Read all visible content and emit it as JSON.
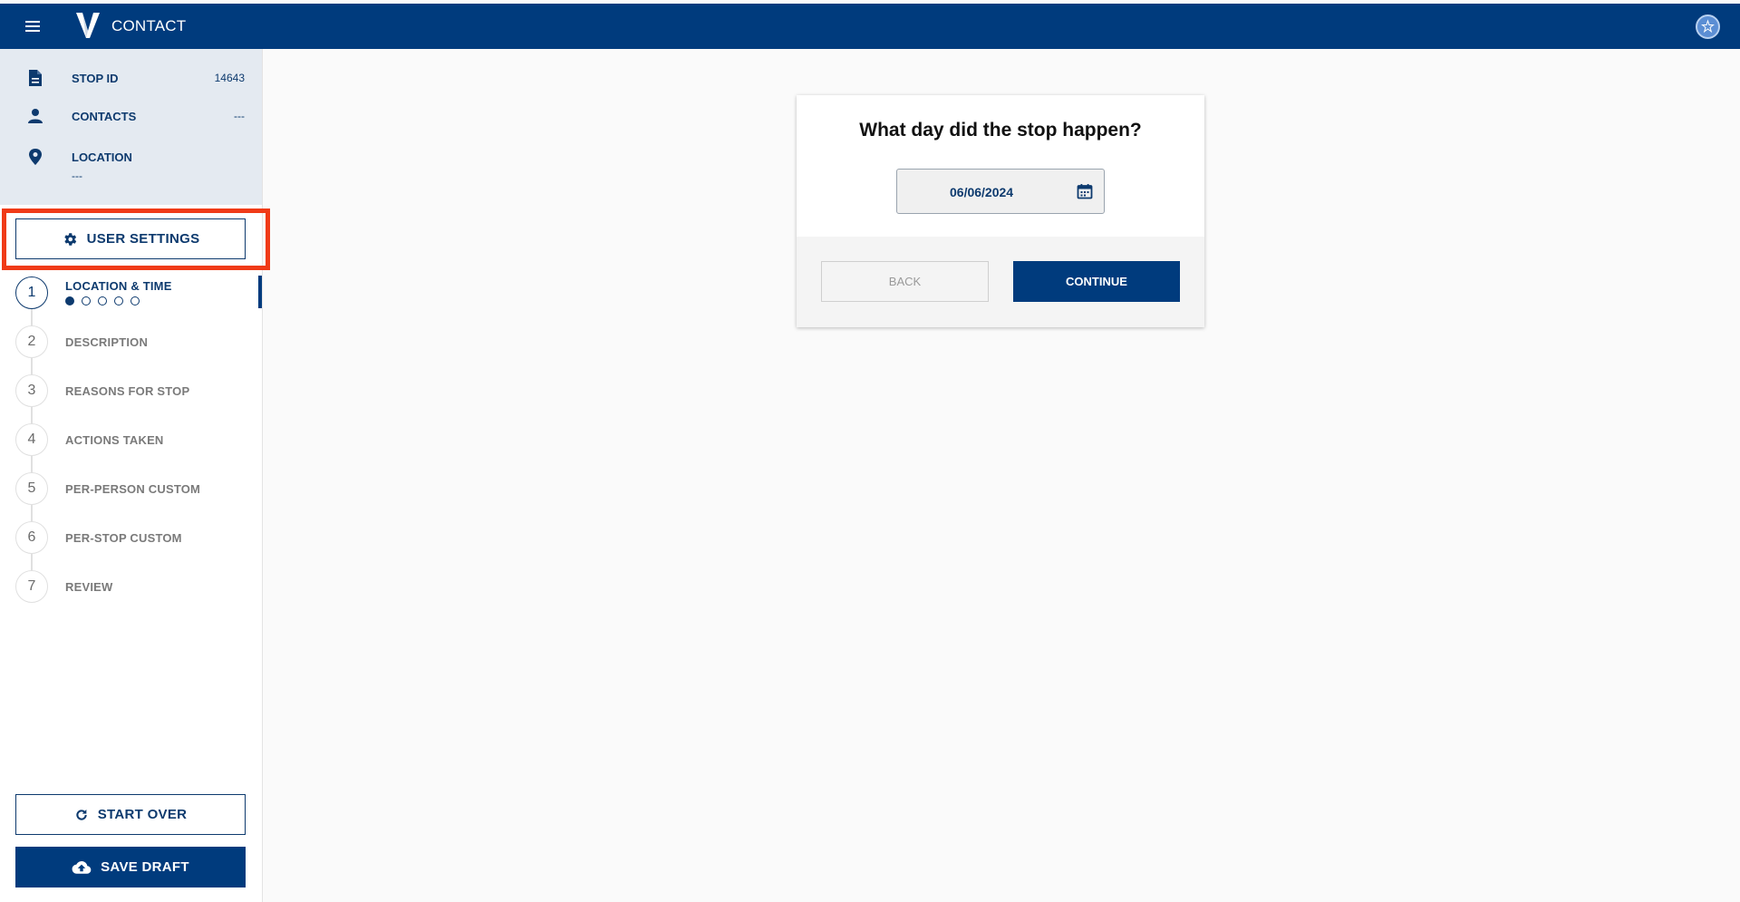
{
  "header": {
    "app_title": "CONTACT",
    "menu_icon": "menu-icon",
    "logo_icon": "v-logo-icon",
    "profile_icon": "badge-icon"
  },
  "summary": {
    "stop_id_label": "STOP ID",
    "stop_id_value": "14643",
    "contacts_label": "CONTACTS",
    "contacts_value": "---",
    "location_label": "LOCATION",
    "location_value": "---"
  },
  "sidebar": {
    "user_settings_label": "USER SETTINGS",
    "start_over_label": "START OVER",
    "save_draft_label": "SAVE DRAFT",
    "steps": [
      {
        "number": "1",
        "label": "LOCATION & TIME"
      },
      {
        "number": "2",
        "label": "DESCRIPTION"
      },
      {
        "number": "3",
        "label": "REASONS FOR STOP"
      },
      {
        "number": "4",
        "label": "ACTIONS TAKEN"
      },
      {
        "number": "5",
        "label": "PER-PERSON CUSTOM"
      },
      {
        "number": "6",
        "label": "PER-STOP CUSTOM"
      },
      {
        "number": "7",
        "label": "REVIEW"
      }
    ],
    "active_step": 1,
    "substep_progress": {
      "current": 1,
      "total": 5
    }
  },
  "main": {
    "question": "What day did the stop happen?",
    "date_value": "06/06/2024",
    "back_label": "BACK",
    "continue_label": "CONTINUE"
  },
  "colors": {
    "primary": "#003b7d",
    "highlight": "#f03a17",
    "summary_bg": "#e4eaf1"
  }
}
